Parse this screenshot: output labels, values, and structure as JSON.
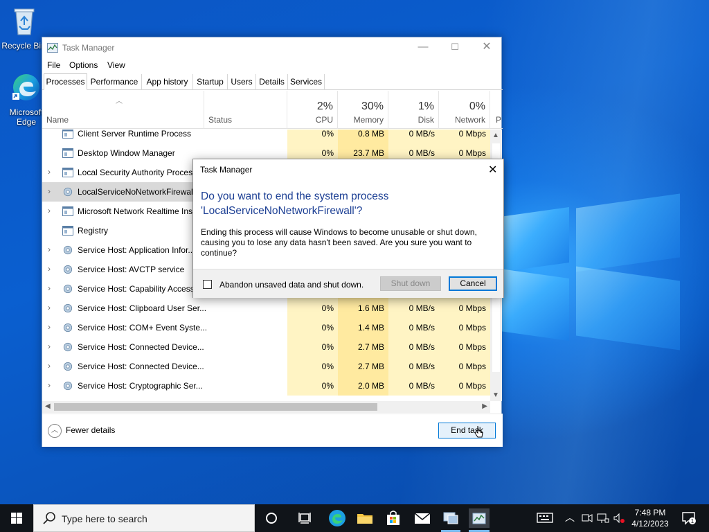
{
  "desktop": {
    "icons": [
      {
        "label": "Recycle Bin",
        "icon": "recycle-bin-icon"
      },
      {
        "label": "Microsoft Edge",
        "icon": "edge-icon"
      }
    ]
  },
  "window": {
    "title": "Task Manager",
    "menu": [
      "File",
      "Options",
      "View"
    ],
    "tabs": [
      "Processes",
      "Performance",
      "App history",
      "Startup",
      "Users",
      "Details",
      "Services"
    ],
    "active_tab": "Processes",
    "columns": {
      "name": "Name",
      "status": "Status",
      "cpu": {
        "pct": "2%",
        "label": "CPU"
      },
      "memory": {
        "pct": "30%",
        "label": "Memory"
      },
      "disk": {
        "pct": "1%",
        "label": "Disk"
      },
      "network": {
        "pct": "0%",
        "label": "Network"
      },
      "power": {
        "label": "P"
      }
    },
    "rows": [
      {
        "name": "Client Server Runtime Process",
        "cpu": "0%",
        "mem": "0.8 MB",
        "disk": "0 MB/s",
        "net": "0 Mbps",
        "expand": false,
        "icon": "window-app-icon"
      },
      {
        "name": "Desktop Window Manager",
        "cpu": "0%",
        "mem": "23.7 MB",
        "disk": "0 MB/s",
        "net": "0 Mbps",
        "expand": false,
        "icon": "window-app-icon"
      },
      {
        "name": "Local Security Authority Process",
        "cpu": "",
        "mem": "",
        "disk": "",
        "net": "",
        "expand": true,
        "icon": "window-app-icon"
      },
      {
        "name": "LocalServiceNoNetworkFirewall",
        "cpu": "",
        "mem": "",
        "disk": "",
        "net": "",
        "expand": true,
        "icon": "gear-icon",
        "selected": true
      },
      {
        "name": "Microsoft Network Realtime Ins...",
        "cpu": "",
        "mem": "",
        "disk": "",
        "net": "",
        "expand": true,
        "icon": "window-app-icon"
      },
      {
        "name": "Registry",
        "cpu": "",
        "mem": "",
        "disk": "",
        "net": "",
        "expand": false,
        "icon": "window-app-icon"
      },
      {
        "name": "Service Host: Application Infor...",
        "cpu": "",
        "mem": "",
        "disk": "",
        "net": "",
        "expand": true,
        "icon": "gear-icon"
      },
      {
        "name": "Service Host: AVCTP service",
        "cpu": "",
        "mem": "",
        "disk": "",
        "net": "",
        "expand": true,
        "icon": "gear-icon"
      },
      {
        "name": "Service Host: Capability Access ...",
        "cpu": "",
        "mem": "",
        "disk": "",
        "net": "",
        "expand": true,
        "icon": "gear-icon"
      },
      {
        "name": "Service Host: Clipboard User Ser...",
        "cpu": "0%",
        "mem": "1.6 MB",
        "disk": "0 MB/s",
        "net": "0 Mbps",
        "expand": true,
        "icon": "gear-icon"
      },
      {
        "name": "Service Host: COM+ Event Syste...",
        "cpu": "0%",
        "mem": "1.4 MB",
        "disk": "0 MB/s",
        "net": "0 Mbps",
        "expand": true,
        "icon": "gear-icon"
      },
      {
        "name": "Service Host: Connected Device...",
        "cpu": "0%",
        "mem": "2.7 MB",
        "disk": "0 MB/s",
        "net": "0 Mbps",
        "expand": true,
        "icon": "gear-icon"
      },
      {
        "name": "Service Host: Connected Device...",
        "cpu": "0%",
        "mem": "2.7 MB",
        "disk": "0 MB/s",
        "net": "0 Mbps",
        "expand": true,
        "icon": "gear-icon"
      },
      {
        "name": "Service Host: Cryptographic Ser...",
        "cpu": "0%",
        "mem": "2.0 MB",
        "disk": "0 MB/s",
        "net": "0 Mbps",
        "expand": true,
        "icon": "gear-icon"
      }
    ],
    "footer": {
      "fewer_details": "Fewer details",
      "end_task": "End task"
    }
  },
  "dialog": {
    "title": "Task Manager",
    "heading": "Do you want to end the system process 'LocalServiceNoNetworkFirewall'?",
    "body": "Ending this process will cause Windows to become unusable or shut down, causing you to lose any data hasn't been saved. Are you sure you want to continue?",
    "checkbox_label": "Abandon unsaved data and shut down.",
    "checkbox_checked": false,
    "btn_shutdown": "Shut down",
    "btn_cancel": "Cancel"
  },
  "taskbar": {
    "search_placeholder": "Type here to search",
    "time": "7:48 PM",
    "date": "4/12/2023",
    "notification_count": "1",
    "accent": "#0078d7"
  }
}
